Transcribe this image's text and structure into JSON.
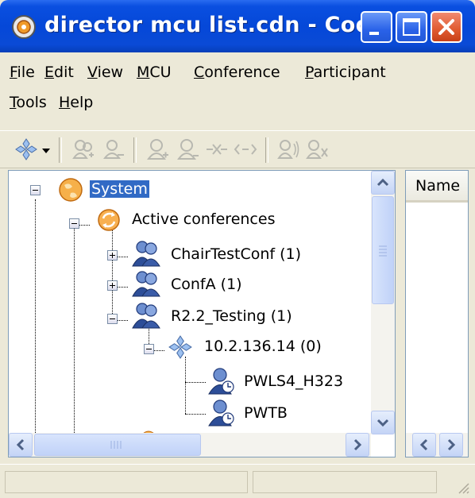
{
  "window": {
    "title": "director mcu list.cdn - Codia..."
  },
  "menu": {
    "row1": [
      {
        "key": "F",
        "rest": "ile"
      },
      {
        "key": "E",
        "rest": "dit"
      },
      {
        "key": "V",
        "rest": "iew"
      },
      {
        "key": "M",
        "rest": "CU"
      },
      {
        "key": "C",
        "rest": "onference"
      },
      {
        "key": "P",
        "rest": "articipant"
      }
    ],
    "row2": [
      {
        "key": "T",
        "rest": "ools"
      },
      {
        "key": "H",
        "rest": "elp"
      }
    ]
  },
  "toolbar": {
    "icons": [
      "mcu-network-dropdown-icon",
      "add-conference-icon",
      "remove-conference-icon",
      "add-participant-icon",
      "remove-participant-icon",
      "connect-icon",
      "disconnect-icon",
      "mute-audio-icon",
      "mute-video-icon"
    ]
  },
  "tree": {
    "root": {
      "label": "System"
    },
    "active": {
      "label": "Active conferences"
    },
    "conferences": [
      {
        "label": "ChairTestConf (1)",
        "expanded": false
      },
      {
        "label": "ConfA (1)",
        "expanded": false
      },
      {
        "label": "R2.2_Testing (1)",
        "expanded": true
      }
    ],
    "mcu": {
      "label": "10.2.136.14 (0)"
    },
    "participants": [
      {
        "label": "PWLS4_H323"
      },
      {
        "label": "PWTB"
      }
    ]
  },
  "list": {
    "column_header": "Name"
  },
  "colors": {
    "titlebar": "#0548d8",
    "selection": "#316ac5",
    "window_bg": "#ece9d8"
  }
}
